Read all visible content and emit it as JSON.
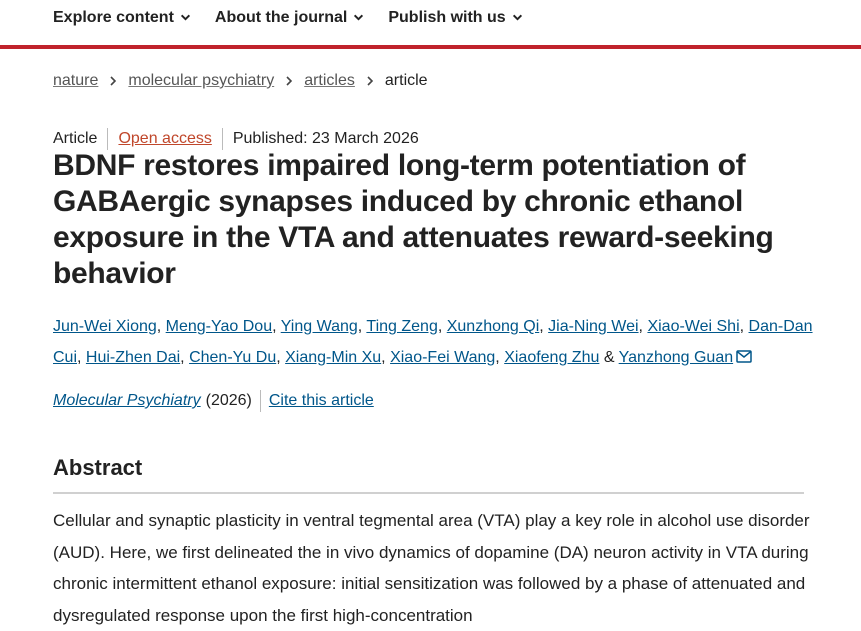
{
  "nav": {
    "items": [
      {
        "label": "Explore content"
      },
      {
        "label": "About the journal"
      },
      {
        "label": "Publish with us"
      }
    ],
    "accent_color": "#c0222b"
  },
  "breadcrumb": {
    "items": [
      "nature",
      "molecular psychiatry",
      "articles"
    ],
    "current": "article"
  },
  "meta": {
    "type": "Article",
    "access": "Open access",
    "published": "Published: 23 March 2026"
  },
  "title": "BDNF restores impaired long-term potentiation of GABAergic synapses induced by chronic ethanol exposure in the VTA and attenuates reward-seeking behavior",
  "authors": {
    "names": [
      "Jun-Wei Xiong",
      "Meng-Yao Dou",
      "Ying Wang",
      "Ting Zeng",
      "Xunzhong Qi",
      "Jia-Ning Wei",
      "Xiao-Wei Shi",
      "Dan-Dan Cui",
      "Hui-Zhen Dai",
      "Chen-Yu Du",
      "Xiang-Min Xu",
      "Xiao-Fei Wang",
      "Xiaofeng Zhu"
    ],
    "last_conjunction": "&",
    "corresponding": "Yanzhong Guan",
    "mail_icon": "envelope-icon"
  },
  "citation": {
    "journal": "Molecular Psychiatry",
    "year": "(2026)",
    "cite_label": "Cite this article"
  },
  "abstract": {
    "heading": "Abstract",
    "text": "Cellular and synaptic plasticity in ventral tegmental area (VTA) play a key role in alcohol use disorder (AUD). Here, we first delineated the in vivo dynamics of dopamine (DA) neuron activity in VTA during chronic intermittent ethanol exposure: initial sensitization was followed by a phase of attenuated and dysregulated response upon the first high-concentration"
  }
}
